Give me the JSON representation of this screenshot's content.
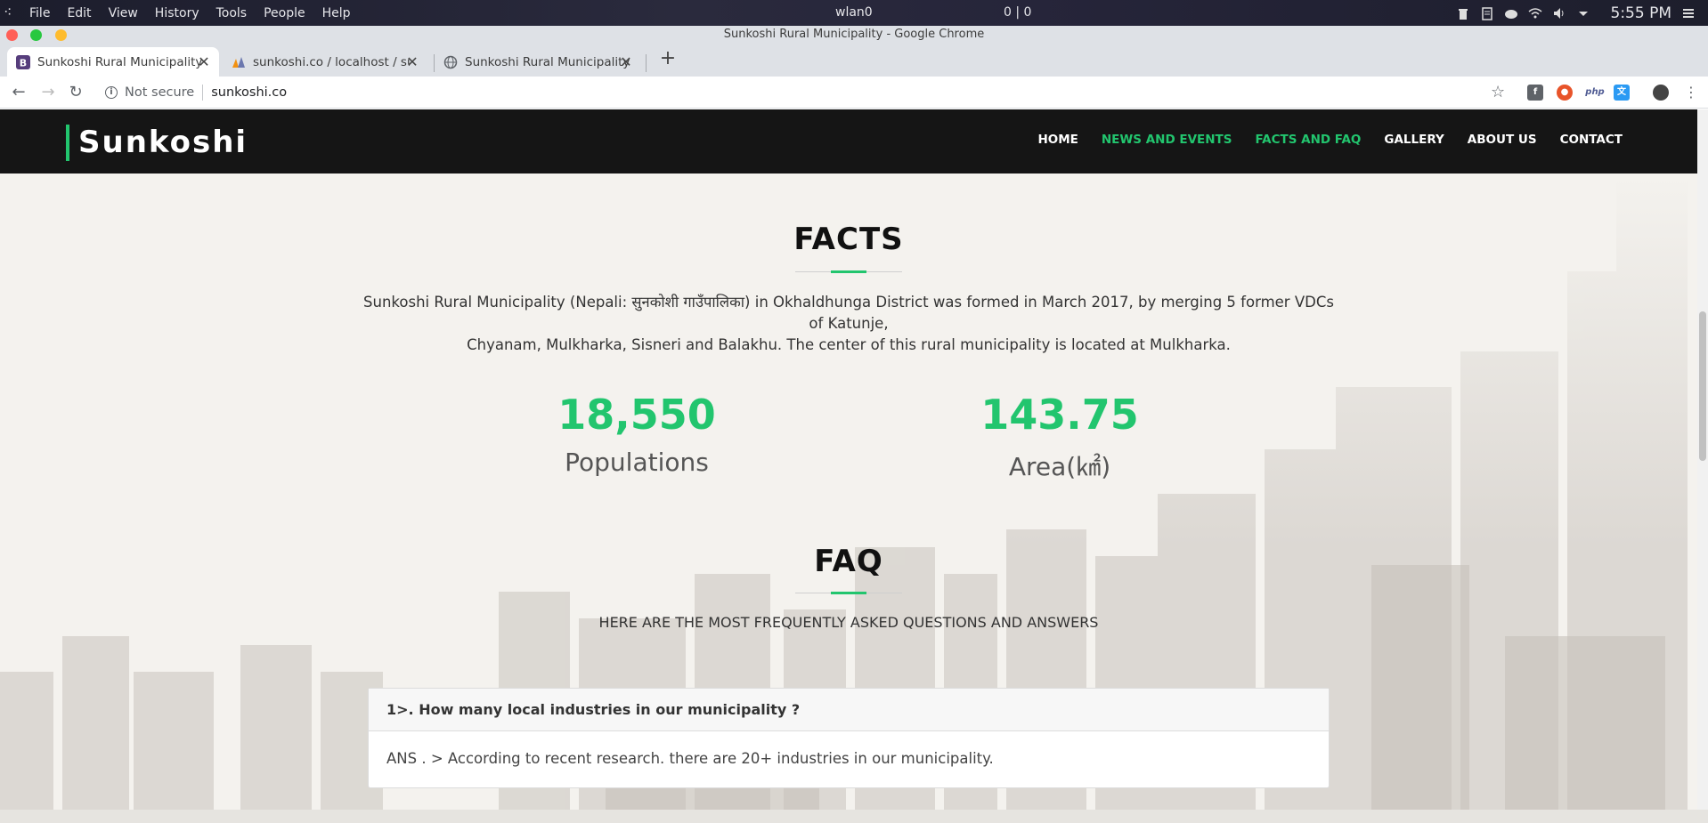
{
  "os": {
    "menu": [
      "File",
      "Edit",
      "View",
      "History",
      "Tools",
      "People",
      "Help"
    ],
    "network": "wlan0",
    "counter": "0 | 0",
    "time": "5:55 PM"
  },
  "window": {
    "title": "Sunkoshi Rural Municipality - Google Chrome"
  },
  "tabs": [
    {
      "label": "Sunkoshi Rural Municipality",
      "icon": "bootstrap-icon",
      "active": true
    },
    {
      "label": "sunkoshi.co / localhost / suni",
      "icon": "phpmyadmin-icon",
      "active": false
    },
    {
      "label": "Sunkoshi Rural Municipality",
      "icon": "globe-icon",
      "active": false
    }
  ],
  "address": {
    "security": "Not secure",
    "url": "sunkoshi.co"
  },
  "site": {
    "brand": "Sunkoshi",
    "nav": [
      "HOME",
      "NEWS AND EVENTS",
      "FACTS AND FAQ",
      "GALLERY",
      "ABOUT US",
      "CONTACT"
    ],
    "facts": {
      "title": "FACTS",
      "line1": "Sunkoshi Rural Municipality (Nepali: सुनकोशी गाउँपालिका) in Okhaldhunga District was formed in March 2017, by merging 5 former VDCs of Katunje,",
      "line2": "Chyanam, Mulkharka, Sisneri and Balakhu. The center of this rural municipality is located at Mulkharka.",
      "stats": [
        {
          "value": "18,550",
          "label": "Populations"
        },
        {
          "value": "143.75",
          "label": "Area(㎢)"
        }
      ]
    },
    "faq": {
      "title": "FAQ",
      "subtitle": "HERE ARE THE MOST FREQUENTLY ASKED QUESTIONS AND ANSWERS",
      "items": [
        {
          "question": "1>. How many local industries in our municipality ?",
          "answer": "ANS . > According to recent research. there are 20+ industries in our municipality."
        }
      ]
    }
  },
  "colors": {
    "accent": "#22c56e",
    "nav_bg": "#151515"
  }
}
